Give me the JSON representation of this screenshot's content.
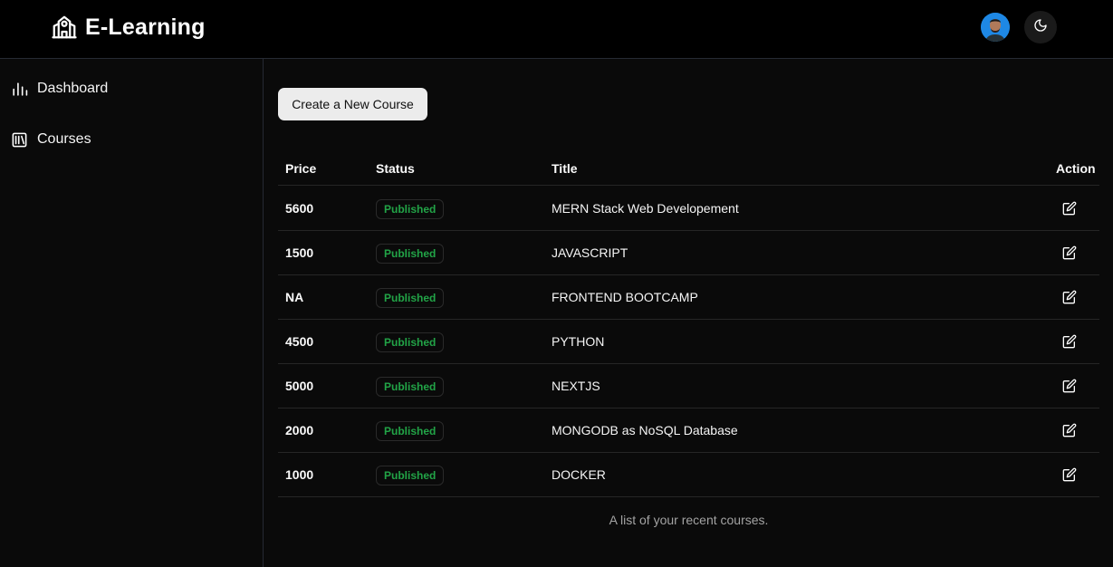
{
  "brand": {
    "name": "E-Learning",
    "icon": "school-icon"
  },
  "header": {
    "avatar_icon": "user-avatar",
    "theme_icon": "moon-icon"
  },
  "sidebar": {
    "items": [
      {
        "label": "Dashboard",
        "icon": "bar-chart-icon"
      },
      {
        "label": "Courses",
        "icon": "library-icon"
      }
    ]
  },
  "main": {
    "create_label": "Create a New Course",
    "columns": {
      "price": "Price",
      "status": "Status",
      "title": "Title",
      "action": "Action"
    },
    "rows": [
      {
        "price": "5600",
        "status": "Published",
        "title": "MERN Stack Web Developement"
      },
      {
        "price": "1500",
        "status": "Published",
        "title": "JAVASCRIPT"
      },
      {
        "price": "NA",
        "status": "Published",
        "title": "FRONTEND BOOTCAMP"
      },
      {
        "price": "4500",
        "status": "Published",
        "title": "PYTHON"
      },
      {
        "price": "5000",
        "status": "Published",
        "title": "NEXTJS"
      },
      {
        "price": "2000",
        "status": "Published",
        "title": "MONGODB as NoSQL Database"
      },
      {
        "price": "1000",
        "status": "Published",
        "title": "DOCKER"
      }
    ],
    "caption": "A list of your recent courses."
  },
  "colors": {
    "published": "#22a447",
    "accent": "#1e88e5",
    "background": "#0a0a0a"
  }
}
